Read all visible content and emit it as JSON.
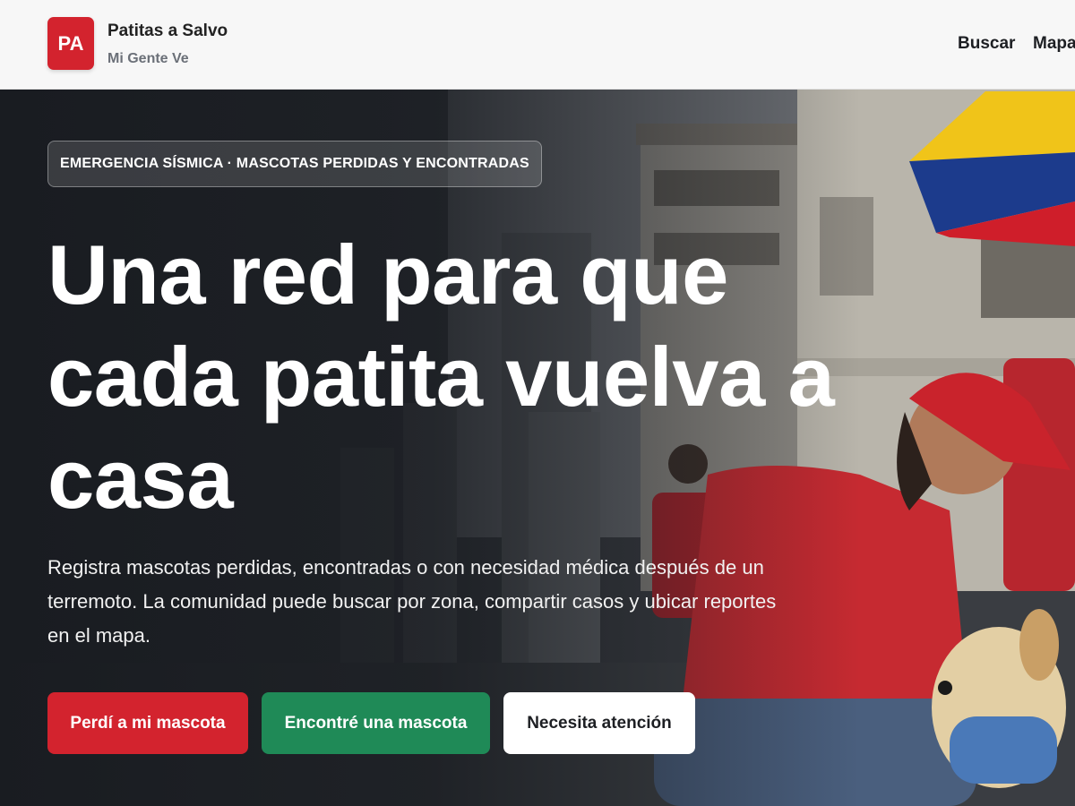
{
  "header": {
    "logo_text": "PA",
    "brand_name": "Patitas a Salvo",
    "brand_subtitle": "Mi Gente Ve",
    "nav": [
      {
        "label": "Buscar"
      },
      {
        "label": "Mapa"
      }
    ]
  },
  "hero": {
    "badge": "EMERGENCIA SÍSMICA · MASCOTAS PERDIDAS Y ENCONTRADAS",
    "headline": "Una red para que cada patita vuelva a casa",
    "description": "Registra mascotas perdidas, encontradas o con necesidad médica después de un terremoto. La comunidad puede buscar por zona, compartir casos y ubicar reportes en el mapa.",
    "buttons": {
      "lost": "Perdí a mi mascota",
      "found": "Encontré una mascota",
      "care": "Necesita atención"
    }
  },
  "colors": {
    "brand_red": "#d3232e",
    "found_green": "#1f8a57",
    "header_bg": "#f7f7f7"
  }
}
